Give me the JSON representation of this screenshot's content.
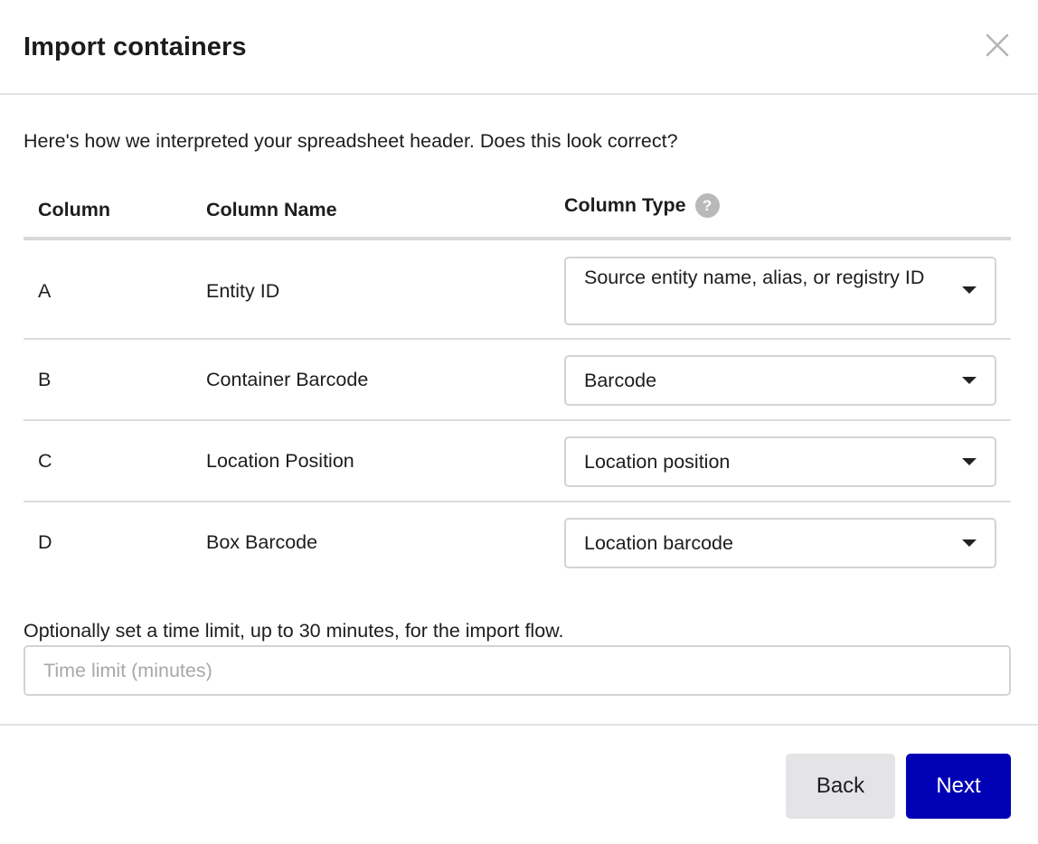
{
  "dialog": {
    "title": "Import containers",
    "intro": "Here's how we interpreted your spreadsheet header. Does this look correct?"
  },
  "table": {
    "headers": {
      "column": "Column",
      "column_name": "Column Name",
      "column_type": "Column Type",
      "help": "?"
    },
    "rows": [
      {
        "letter": "A",
        "name": "Entity ID",
        "type": "Source entity name, alias, or registry ID"
      },
      {
        "letter": "B",
        "name": "Container Barcode",
        "type": "Barcode"
      },
      {
        "letter": "C",
        "name": "Location Position",
        "type": "Location position"
      },
      {
        "letter": "D",
        "name": "Box Barcode",
        "type": "Location barcode"
      }
    ]
  },
  "time_limit": {
    "label": "Optionally set a time limit, up to 30 minutes, for the import flow.",
    "value": "",
    "placeholder": "Time limit (minutes)"
  },
  "footer": {
    "back_label": "Back",
    "next_label": "Next"
  },
  "colors": {
    "primary": "#0000b4",
    "secondary_button": "#e4e4e6",
    "help_icon": "#b9b9b9"
  },
  "icons": {
    "close": "close-icon",
    "help": "help-icon",
    "dropdown": "chevron-down-icon"
  }
}
